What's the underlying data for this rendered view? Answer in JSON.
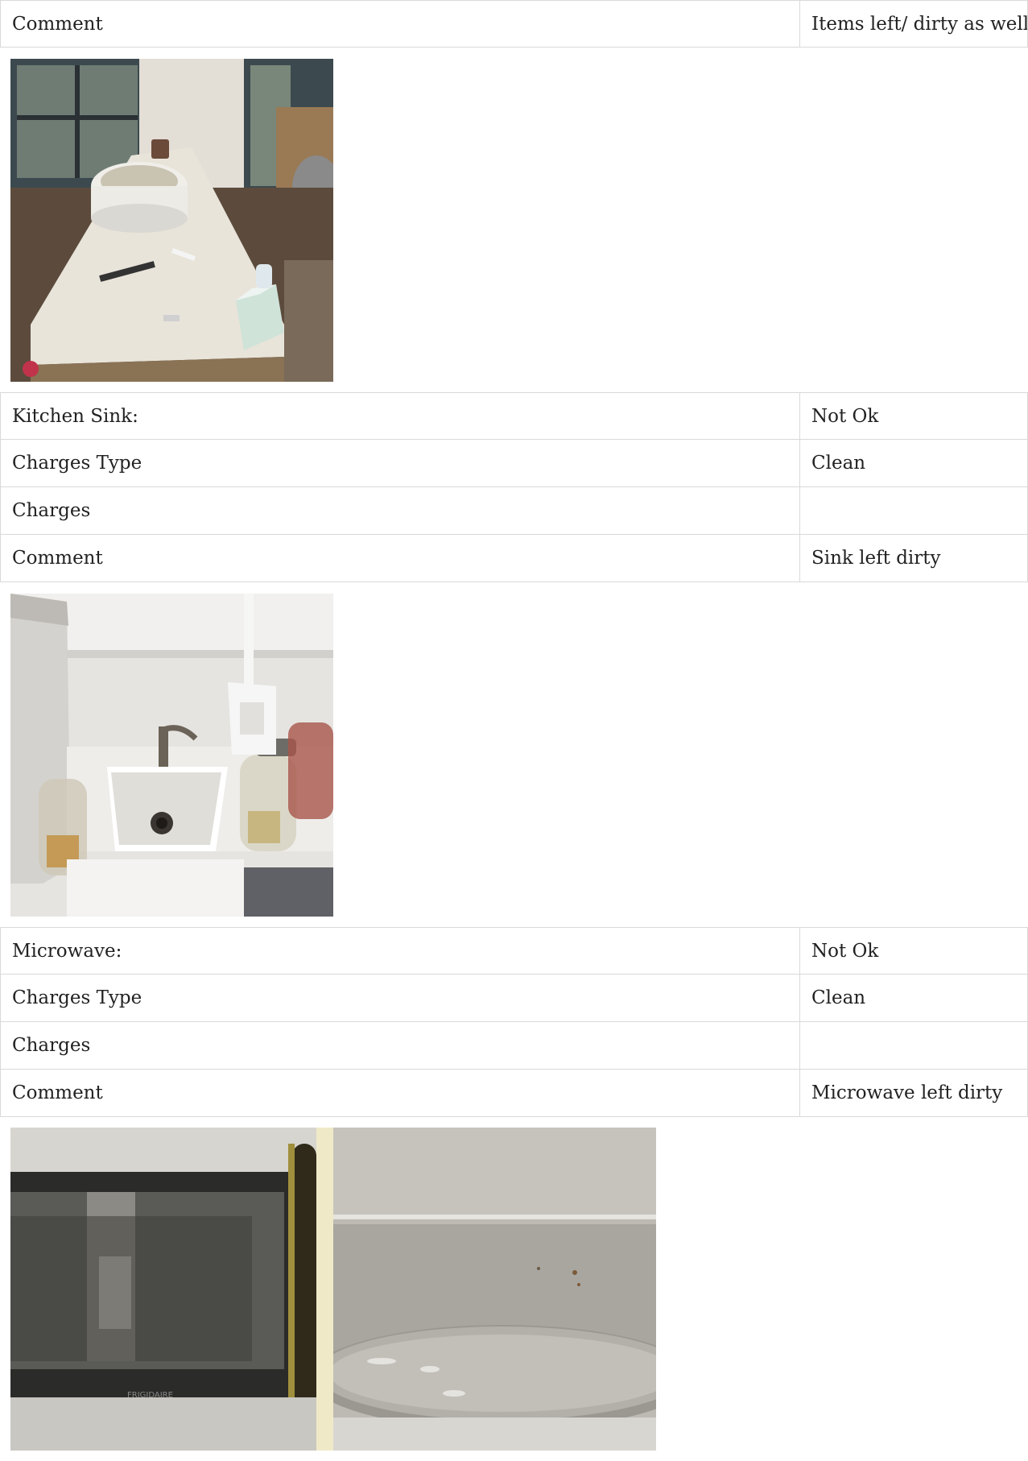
{
  "sections": [
    {
      "rows": [
        {
          "label": "Comment",
          "value": "Items left/ dirty as well"
        }
      ],
      "photos": [
        {
          "icon": "kitchen-counter-photo"
        }
      ]
    },
    {
      "rows": [
        {
          "label": "Kitchen Sink:",
          "value": "Not Ok"
        },
        {
          "label": "Charges Type",
          "value": "Clean"
        },
        {
          "label": "Charges",
          "value": ""
        },
        {
          "label": "Comment",
          "value": "Sink left dirty"
        }
      ],
      "photos": [
        {
          "icon": "kitchen-sink-photo"
        }
      ]
    },
    {
      "rows": [
        {
          "label": "Microwave:",
          "value": "Not Ok"
        },
        {
          "label": "Charges Type",
          "value": "Clean"
        },
        {
          "label": "Charges",
          "value": ""
        },
        {
          "label": "Comment",
          "value": "Microwave left dirty"
        }
      ],
      "photos": [
        {
          "icon": "microwave-door-photo",
          "brand_text": "FRIGIDAIRE"
        },
        {
          "icon": "microwave-interior-photo"
        }
      ]
    }
  ]
}
